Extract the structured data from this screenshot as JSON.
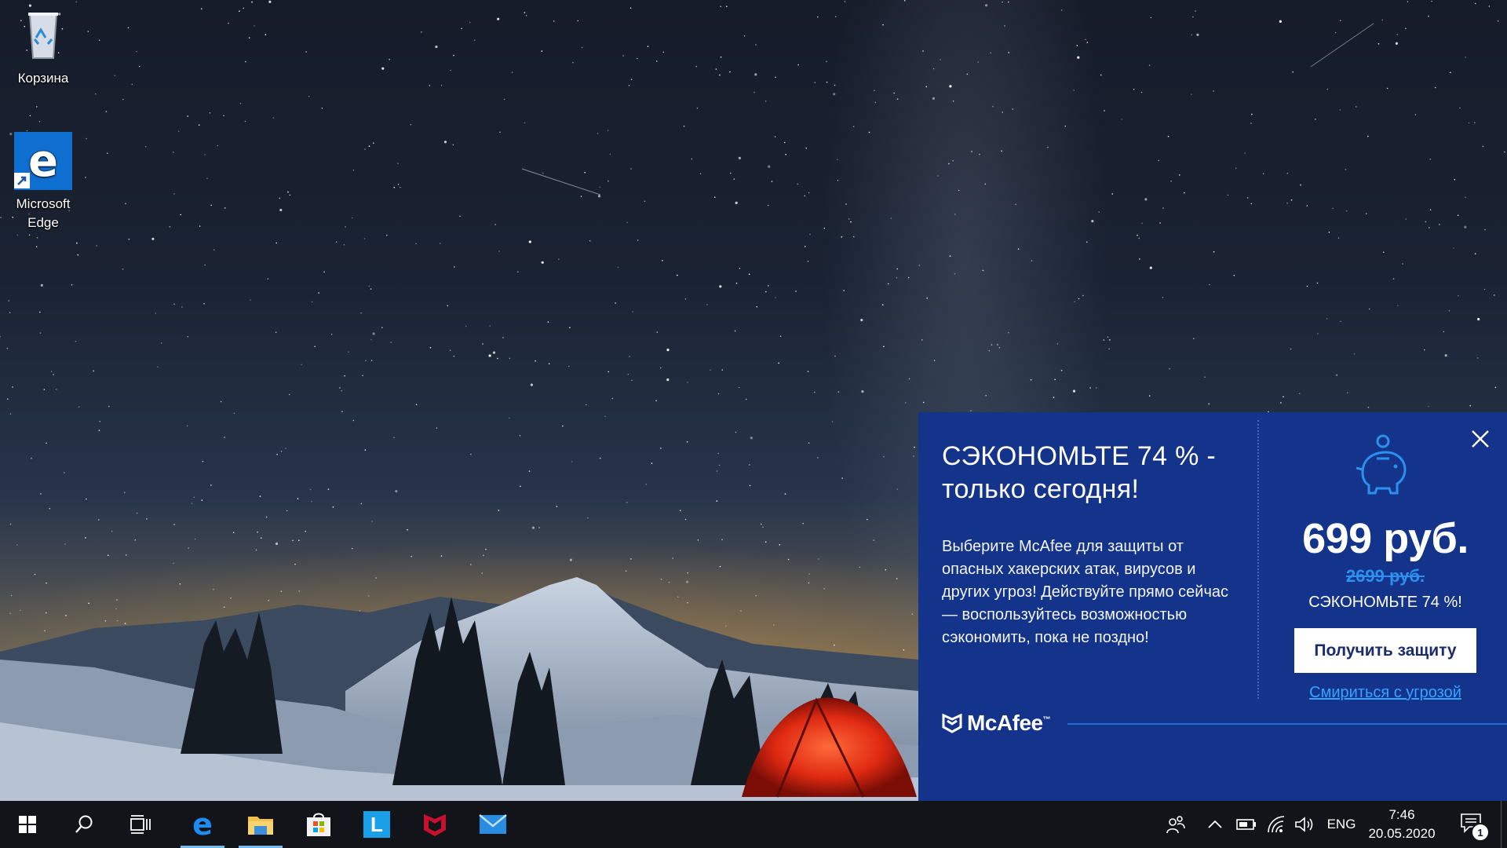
{
  "desktop": {
    "icons": [
      {
        "label": "Корзина",
        "icon": "recycle-bin-icon"
      },
      {
        "label": "Microsoft Edge",
        "icon": "edge-icon"
      }
    ]
  },
  "popup": {
    "headline": "СЭКОНОМЬТЕ 74 % - только сегодня!",
    "body": "Выберите McAfee для защиты от опасных хакерских атак, вирусов и других угроз! Действуйте прямо сейчас — воспользуйтесь возможностью сэкономить, пока не поздно!",
    "price": "699 руб.",
    "old_price": "2699 руб.",
    "save_text": "СЭКОНОМЬТЕ 74 %!",
    "cta_label": "Получить защиту",
    "reject_label": "Смириться с угрозой",
    "brand": "McAfee",
    "brand_mark": "™",
    "colors": {
      "background": "#14338a",
      "accent": "#2b90ee",
      "link": "#35a4ff"
    }
  },
  "taskbar": {
    "apps": [
      {
        "name": "Microsoft Edge",
        "icon": "edge-icon",
        "active": true
      },
      {
        "name": "File Explorer",
        "icon": "folder-icon",
        "active": true
      },
      {
        "name": "Microsoft Store",
        "icon": "store-icon",
        "active": false
      },
      {
        "name": "L app",
        "icon": "l-app-icon",
        "letter": "L",
        "active": false
      },
      {
        "name": "McAfee",
        "icon": "mcafee-icon",
        "active": false
      },
      {
        "name": "Mail",
        "icon": "mail-icon",
        "active": false
      }
    ],
    "tray": {
      "language": "ENG",
      "time": "7:46",
      "date": "20.05.2020",
      "notification_count": "1"
    }
  }
}
